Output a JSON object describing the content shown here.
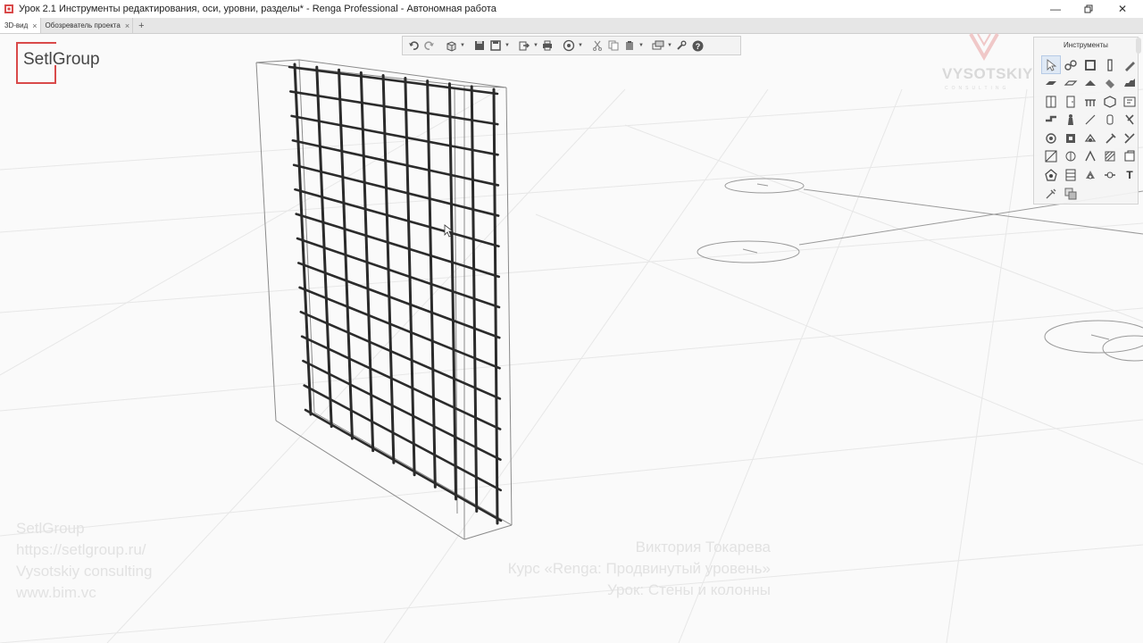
{
  "window": {
    "title": "Урок 2.1 Инструменты редактирования, оси, уровни, разделы* - Renga Professional - Автономная работа",
    "controls": [
      "minimize-icon",
      "restore-icon",
      "close-icon"
    ]
  },
  "tabs": [
    {
      "label": "3D-вид",
      "active": true
    },
    {
      "label": "Обозреватель проекта",
      "active": false
    }
  ],
  "tabs_add_label": "+",
  "toolbar": {
    "items": [
      "undo-icon",
      "redo-icon",
      "view-cube-icon",
      "save-icon",
      "save-as-icon",
      "export-icon",
      "print-icon",
      "navigation-icon",
      "cut-icon",
      "copy-icon",
      "paste-icon",
      "layers-icon",
      "settings-wrench-icon",
      "help-icon"
    ]
  },
  "tools_panel": {
    "title": "Инструменты",
    "text_tool_label": "T",
    "tools": [
      "select-icon",
      "link-icon",
      "wall-icon",
      "column-icon",
      "pencil-icon",
      "beam-icon",
      "slab-icon",
      "roof-icon",
      "ramp-icon",
      "stair-icon",
      "window-icon",
      "door-icon",
      "railing-icon",
      "opening-icon",
      "room-icon",
      "pipe-icon",
      "equipment-icon",
      "line-icon",
      "element-icon",
      "fitting-icon",
      "rebar-icon",
      "assembly-icon",
      "reinforcement-icon",
      "dimension-icon",
      "elevation-icon",
      "section-icon",
      "axis-icon",
      "level-icon",
      "hatch-icon",
      "zone-icon",
      "annotation-icon",
      "schedule-icon",
      "sheet-icon",
      "tag-icon",
      "text-icon",
      "measure-icon",
      "merge-icon"
    ]
  },
  "branding": {
    "logo_text": "SetlGroup",
    "vendor_name": "VYSOTSKIY",
    "vendor_sub": "CONSULTING"
  },
  "watermark": {
    "left_lines": [
      "SetlGroup",
      "https://setlgroup.ru/",
      "Vysotskiy consulting",
      "www.bim.vc"
    ],
    "right_lines": [
      "Виктория Токарева",
      "Курс «Renga: Продвинутый уровень»",
      "Урок: Стены и колонны"
    ]
  },
  "colors": {
    "accent": "#d94a4a",
    "background": "#fafafa",
    "panel": "#f3f3f3",
    "rebar": "#2b2b2b"
  }
}
